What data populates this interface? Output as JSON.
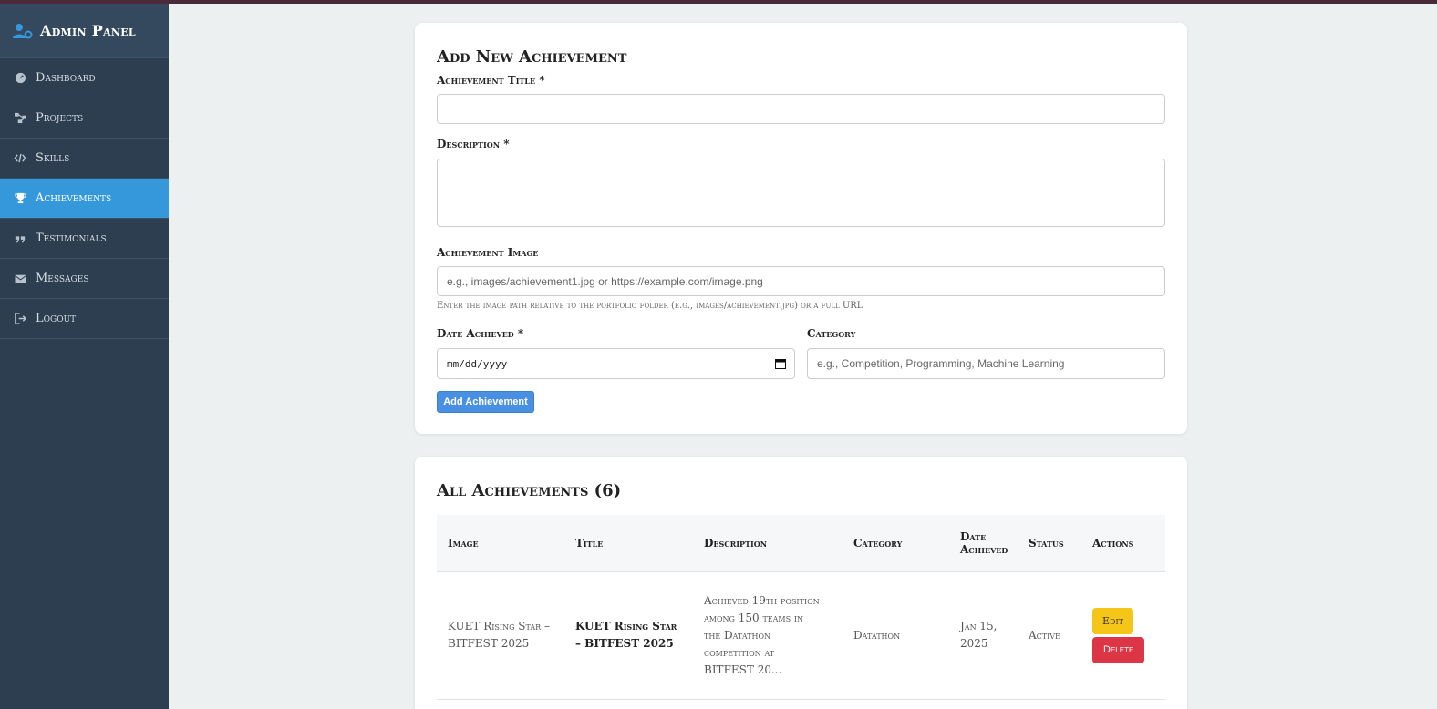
{
  "sidebar": {
    "brand": "Admin Panel",
    "items": [
      {
        "label": "Dashboard",
        "icon": "dashboard-icon"
      },
      {
        "label": "Projects",
        "icon": "projects-icon"
      },
      {
        "label": "Skills",
        "icon": "code-icon"
      },
      {
        "label": "Achievements",
        "icon": "trophy-icon",
        "active": true
      },
      {
        "label": "Testimonials",
        "icon": "quote-icon"
      },
      {
        "label": "Messages",
        "icon": "envelope-icon"
      },
      {
        "label": "Logout",
        "icon": "logout-icon"
      }
    ]
  },
  "form": {
    "heading": "Add New Achievement",
    "title_label": "Achievement Title *",
    "title_value": "",
    "description_label": "Description *",
    "description_value": "",
    "image_label": "Achievement Image",
    "image_placeholder": "e.g., images/achievement1.jpg or https://example.com/image.png",
    "image_hint": "Enter the image path relative to the portfolio folder (e.g., images/achievement.jpg) or a full URL",
    "date_label": "Date Achieved *",
    "date_placeholder": "mm/dd/yyyy",
    "category_label": "Category",
    "category_placeholder": "e.g., Competition, Programming, Machine Learning",
    "submit_label": "Add Achievement"
  },
  "list": {
    "heading": "All Achievements (6)",
    "columns": [
      "Image",
      "Title",
      "Description",
      "Category",
      "Date Achieved",
      "Status",
      "Actions"
    ],
    "rows": [
      {
        "image_alt": "KUET Rising Star – BITFEST 2025",
        "title": "KUET Rising Star – BITFEST 2025",
        "description": "Achieved 19th position among 150 teams in the Datathon competition at BITFEST 20...",
        "category": "Datathon",
        "date": "Jan 15, 2025",
        "status": "Active",
        "edit_label": "Edit",
        "delete_label": "Delete"
      }
    ]
  },
  "colors": {
    "sidebar_bg": "#2c3e50",
    "active_nav": "#3498db",
    "primary_button": "#4a90e2",
    "edit_button": "#f5c518",
    "delete_button": "#dc3545"
  }
}
